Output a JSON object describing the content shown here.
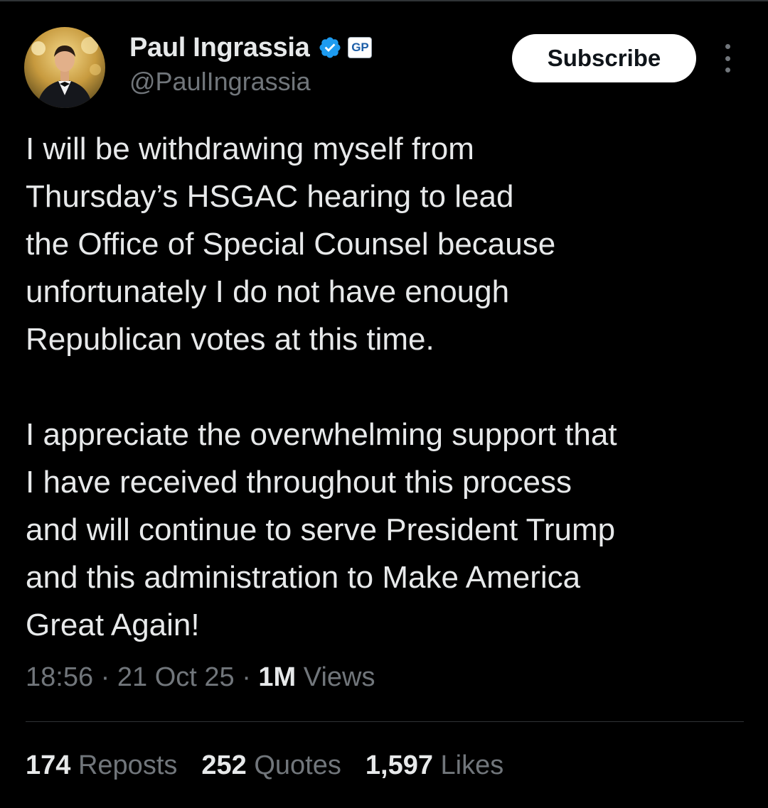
{
  "author": {
    "display_name": "Paul Ingrassia",
    "handle": "@PaulIngrassia",
    "affiliate_badge": "GP",
    "verified_color": "#1d9bf0"
  },
  "header": {
    "subscribe_label": "Subscribe",
    "more_icon": "more-vertical-icon"
  },
  "tweet": {
    "paragraphs": [
      [
        "I will be withdrawing myself from",
        "Thursday’s HSGAC hearing to lead",
        "the Office of Special Counsel because",
        "unfortunately I do not have enough",
        "Republican votes at this time."
      ],
      [
        "I appreciate the overwhelming support that",
        "I have received throughout this process",
        "and will continue to serve President Trump",
        "and this administration to Make America",
        "Great Again!"
      ]
    ]
  },
  "meta": {
    "time": "18:56",
    "separator": "·",
    "date": "21 Oct 25",
    "views_count": "1M",
    "views_label": "Views"
  },
  "stats": [
    {
      "count": "174",
      "label": "Reposts"
    },
    {
      "count": "252",
      "label": "Quotes"
    },
    {
      "count": "1,597",
      "label": "Likes"
    }
  ]
}
